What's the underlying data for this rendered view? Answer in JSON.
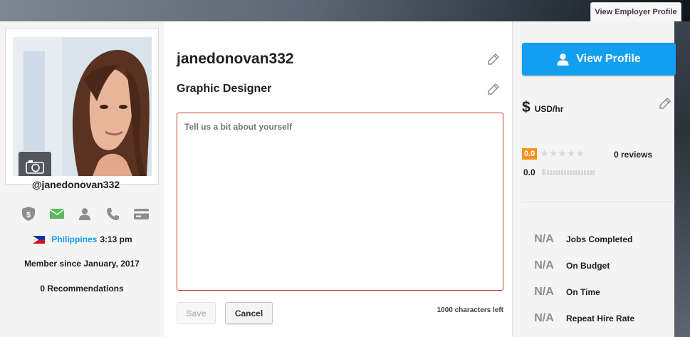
{
  "header": {
    "employer_button": "View Employer Profile"
  },
  "profile": {
    "handle": "@janedonovan332",
    "country": "Philippines",
    "local_time": "3:13 pm",
    "member_since": "Member since January, 2017",
    "recommendations": "0 Recommendations",
    "verification_icons": [
      "shield-dollar-icon",
      "envelope-icon",
      "user-icon",
      "phone-icon",
      "credit-card-icon"
    ],
    "verified_color": "#5cb85c",
    "unverified_color": "#8b8e93"
  },
  "main": {
    "username": "janedonovan332",
    "headline": "Graphic Designer",
    "about_placeholder": "Tell us a bit about yourself",
    "save_label": "Save",
    "cancel_label": "Cancel",
    "char_count": "1000 characters left"
  },
  "sidebar": {
    "view_profile_label": "View Profile",
    "currency_symbol": "$",
    "rate_unit": "USD/hr",
    "rating_badge": "0.0",
    "stars": "★★★★★",
    "star_fill": 0,
    "reviews": "0 reviews",
    "earnings_score": "0.0",
    "earnings_symbol": "$",
    "stats": [
      {
        "value": "N/A",
        "label": "Jobs Completed"
      },
      {
        "value": "N/A",
        "label": "On Budget"
      },
      {
        "value": "N/A",
        "label": "On Time"
      },
      {
        "value": "N/A",
        "label": "Repeat Hire Rate"
      }
    ],
    "accent_color": "#139ff0",
    "badge_color": "#f6921e"
  }
}
